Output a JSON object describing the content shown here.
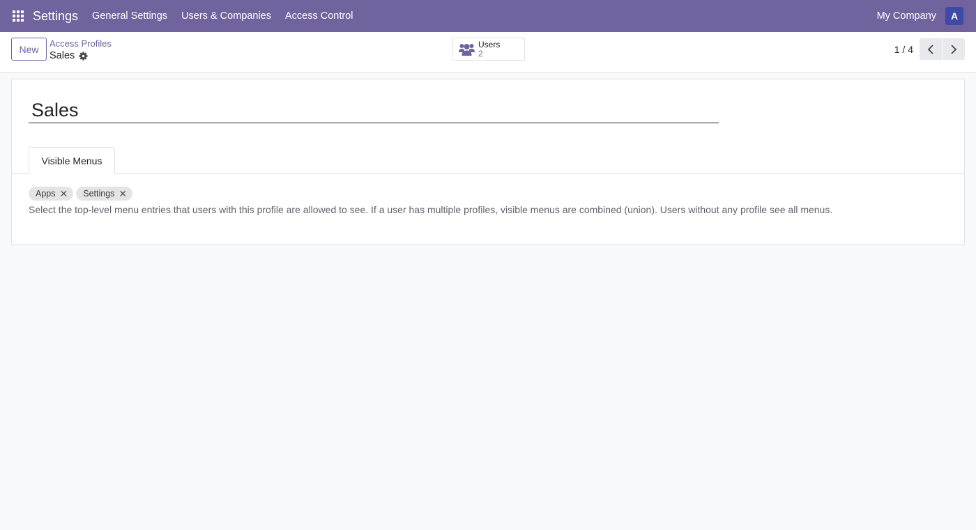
{
  "navbar": {
    "app_title": "Settings",
    "menu": [
      "General Settings",
      "Users & Companies",
      "Access Control"
    ],
    "company": "My Company",
    "avatar_initial": "A",
    "bg_color": "#71639e",
    "avatar_color": "#3e4aa8"
  },
  "control_panel": {
    "new_label": "New",
    "breadcrumb_parent": "Access Profiles",
    "breadcrumb_current": "Sales",
    "smart_button": {
      "label": "Users",
      "value": "2",
      "icon": "users-icon"
    },
    "pager": {
      "value": "1 / 4"
    }
  },
  "form": {
    "name": "Sales",
    "tab_label": "Visible Menus",
    "tags": [
      {
        "label": "Apps"
      },
      {
        "label": "Settings"
      }
    ],
    "help": "Select the top-level menu entries that users with this profile are allowed to see. If a user has multiple profiles, visible menus are combined (union). Users without any profile see all menus."
  }
}
